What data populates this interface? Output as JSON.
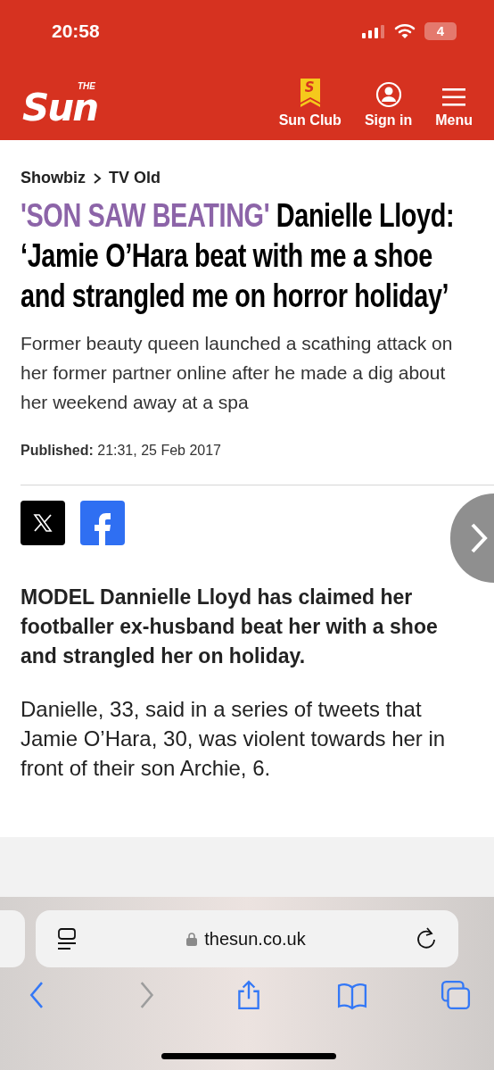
{
  "status_bar": {
    "time": "20:58",
    "battery": "4"
  },
  "header": {
    "logo_small": "THE",
    "logo": "Sun",
    "actions": [
      {
        "kind": "club",
        "label": "Sun Club",
        "badge": "S"
      },
      {
        "kind": "account",
        "label": "Sign in"
      },
      {
        "kind": "menu",
        "label": "Menu"
      }
    ]
  },
  "breadcrumb": [
    "Showbiz",
    "TV Old"
  ],
  "headline": {
    "kicker": "'SON SAW BEATING'",
    "title": "Danielle Lloyd: ‘Jamie O’Hara beat with me a shoe and strangled me on horror holiday’"
  },
  "standfirst": "Former beauty queen launched a scathing attack on her former partner online after he made a dig about her weekend away at a spa",
  "published": {
    "label": "Published:",
    "value": "21:31, 25 Feb 2017"
  },
  "share": [
    {
      "kind": "x"
    },
    {
      "kind": "facebook"
    }
  ],
  "body": [
    {
      "kind": "lead",
      "text": "MODEL Dannielle Lloyd has claimed her footballer ex-husband beat her with a shoe and strangled her on holiday."
    },
    {
      "kind": "para",
      "text": "Danielle, 33, said in a series of tweets that Jamie O’Hara, 30, was violent towards her in front of their son Archie, 6."
    }
  ],
  "browser": {
    "url": "thesun.co.uk",
    "nav": [
      {
        "kind": "back",
        "disabled": false
      },
      {
        "kind": "forward",
        "disabled": true
      },
      {
        "kind": "share",
        "disabled": false
      },
      {
        "kind": "bookmarks",
        "disabled": false
      },
      {
        "kind": "tabs",
        "disabled": false
      }
    ]
  }
}
